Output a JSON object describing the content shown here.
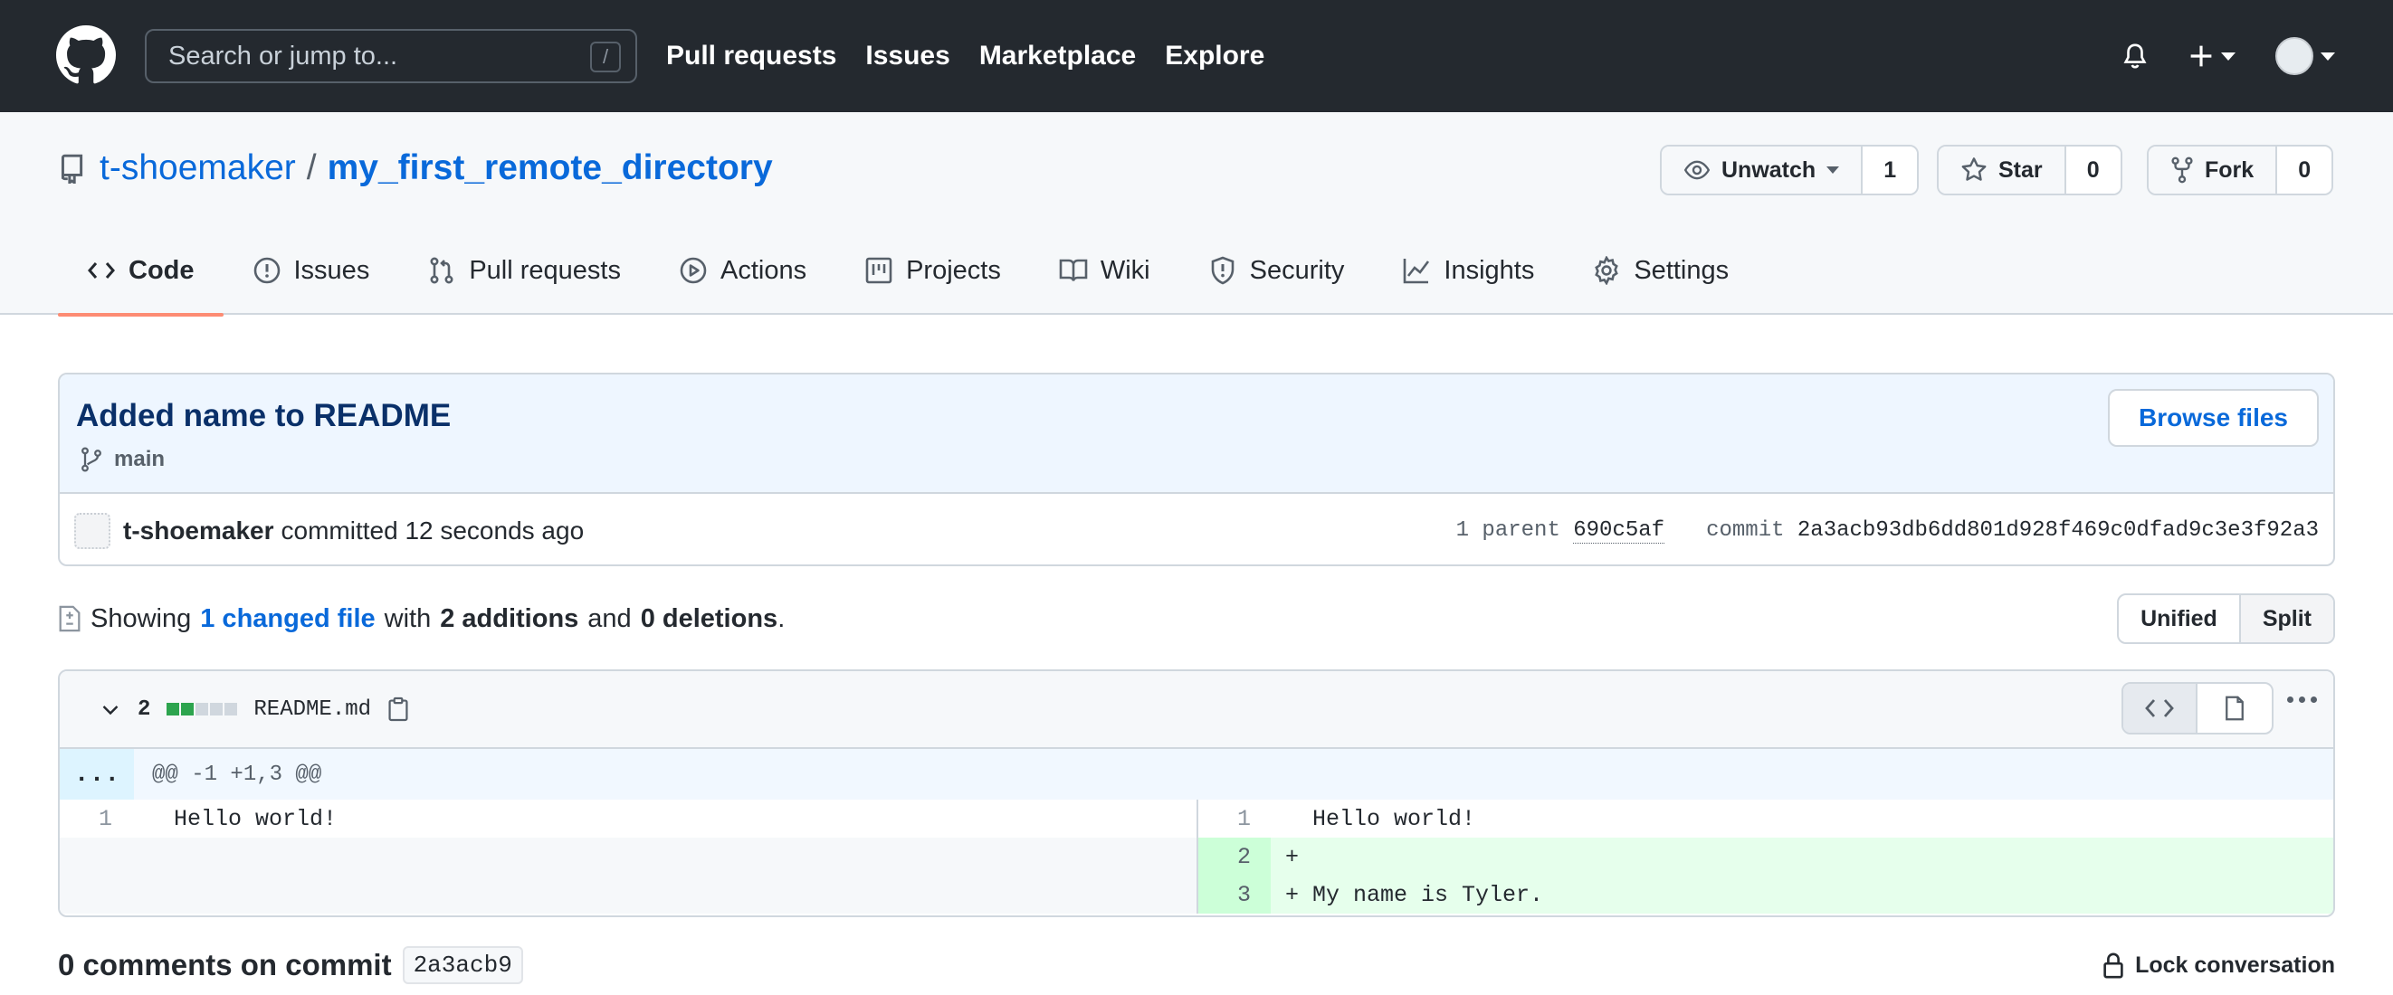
{
  "colors": {
    "header_bg": "#24292f",
    "link": "#0969da",
    "tab_underline": "#fd8c73",
    "addition_bg": "#e6ffec",
    "addition_line_bg": "#ccffd8",
    "diffstat_added": "#2da44e",
    "diffstat_neutral": "#d0d7de"
  },
  "header": {
    "search_placeholder": "Search or jump to...",
    "search_shortcut": "/",
    "nav": [
      "Pull requests",
      "Issues",
      "Marketplace",
      "Explore"
    ]
  },
  "repo": {
    "owner": "t-shoemaker",
    "separator": "/",
    "name": "my_first_remote_directory",
    "watch": {
      "label": "Unwatch",
      "count": "1"
    },
    "star": {
      "label": "Star",
      "count": "0"
    },
    "fork": {
      "label": "Fork",
      "count": "0"
    },
    "tabs": [
      {
        "label": "Code",
        "icon": "code-icon"
      },
      {
        "label": "Issues",
        "icon": "issue-icon"
      },
      {
        "label": "Pull requests",
        "icon": "pull-request-icon"
      },
      {
        "label": "Actions",
        "icon": "play-icon"
      },
      {
        "label": "Projects",
        "icon": "project-icon"
      },
      {
        "label": "Wiki",
        "icon": "book-icon"
      },
      {
        "label": "Security",
        "icon": "shield-icon"
      },
      {
        "label": "Insights",
        "icon": "graph-icon"
      },
      {
        "label": "Settings",
        "icon": "gear-icon"
      }
    ]
  },
  "commit": {
    "title": "Added name to README",
    "branch": "main",
    "browse_label": "Browse files",
    "author": "t-shoemaker",
    "action_text": "committed 12 seconds ago",
    "parent_label": "1 parent",
    "parent_sha": "690c5af",
    "commit_label": "commit",
    "sha": "2a3acb93db6dd801d928f469c0dfad9c3e3f92a3"
  },
  "summary": {
    "showing": "Showing",
    "changed": "1 changed file",
    "with": "with",
    "additions": "2 additions",
    "and": "and",
    "deletions": "0 deletions",
    "period": ".",
    "unified": "Unified",
    "split": "Split"
  },
  "diff": {
    "count": "2",
    "diffstat": [
      "added",
      "added",
      "neutral",
      "neutral",
      "neutral"
    ],
    "filename": "README.md",
    "hunk_expand": "...",
    "hunk_header": "@@ -1 +1,3 @@",
    "rows": [
      {
        "left_num": "1",
        "left_code": "  Hello world!",
        "right_num": "1",
        "right_code": "  Hello world!",
        "type": "context"
      },
      {
        "left_num": "",
        "left_code": "",
        "right_num": "2",
        "right_code": "+",
        "type": "add"
      },
      {
        "left_num": "",
        "left_code": "",
        "right_num": "3",
        "right_code": "+ My name is Tyler.",
        "type": "add"
      }
    ]
  },
  "comments": {
    "title": "0 comments on commit",
    "sha_short": "2a3acb9",
    "lock_label": "Lock conversation"
  }
}
